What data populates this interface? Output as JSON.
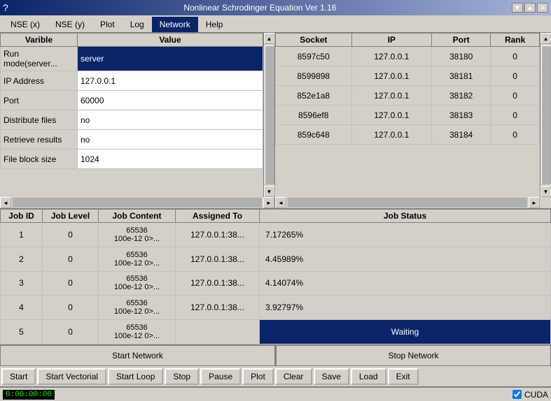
{
  "window": {
    "title": "Nonlinear Schrodinger Equation Ver 1.16",
    "icon": "app-icon"
  },
  "titlebar": {
    "minimize": "▼",
    "maximize": "▲",
    "close": "✕"
  },
  "menu": {
    "items": [
      {
        "label": "NSE (x)",
        "active": false
      },
      {
        "label": "NSE (y)",
        "active": false
      },
      {
        "label": "Plot",
        "active": false
      },
      {
        "label": "Log",
        "active": false
      },
      {
        "label": "Network",
        "active": true
      },
      {
        "label": "Help",
        "active": false
      }
    ]
  },
  "variables": {
    "header_varible": "Varible",
    "header_value": "Value",
    "rows": [
      {
        "label": "Run mode(server...",
        "value": "server",
        "highlight": true
      },
      {
        "label": "IP Address",
        "value": "127.0.0.1",
        "highlight": false
      },
      {
        "label": "Port",
        "value": "60000",
        "highlight": false
      },
      {
        "label": "Distribute files",
        "value": "no",
        "highlight": false
      },
      {
        "label": "Retrieve results",
        "value": "no",
        "highlight": false
      },
      {
        "label": "File block size",
        "value": "1024",
        "highlight": false
      }
    ]
  },
  "sockets": {
    "headers": [
      "Socket",
      "IP",
      "Port",
      "Rank"
    ],
    "rows": [
      {
        "socket": "8597c50",
        "ip": "127.0.0.1",
        "port": "38180",
        "rank": "0"
      },
      {
        "socket": "8599898",
        "ip": "127.0.0.1",
        "port": "38181",
        "rank": "0"
      },
      {
        "socket": "852e1a8",
        "ip": "127.0.0.1",
        "port": "38182",
        "rank": "0"
      },
      {
        "socket": "8596ef8",
        "ip": "127.0.0.1",
        "port": "38183",
        "rank": "0"
      },
      {
        "socket": "859c648",
        "ip": "127.0.0.1",
        "port": "38184",
        "rank": "0"
      }
    ]
  },
  "jobs": {
    "headers": [
      "Job ID",
      "Job Level",
      "Job Content",
      "Assigned To",
      "Job Status"
    ],
    "rows": [
      {
        "id": "1",
        "level": "0",
        "content": "65536\n100e-12 0>...",
        "assigned": "127.0.0.1:38...",
        "status": "7.17265%",
        "waiting": false
      },
      {
        "id": "2",
        "level": "0",
        "content": "65536\n100e-12 0>...",
        "assigned": "127.0.0.1:38...",
        "status": "4.45989%",
        "waiting": false
      },
      {
        "id": "3",
        "level": "0",
        "content": "65536\n100e-12 0>...",
        "assigned": "127.0.0.1:38...",
        "status": "4.14074%",
        "waiting": false
      },
      {
        "id": "4",
        "level": "0",
        "content": "65536\n100e-12 0>...",
        "assigned": "127.0.0.1:38...",
        "status": "3.92797%",
        "waiting": false
      },
      {
        "id": "5",
        "level": "0",
        "content": "65536\n100e-12 0>...",
        "assigned": "",
        "status": "Waiting",
        "waiting": true
      }
    ]
  },
  "network_buttons": {
    "start": "Start Network",
    "stop": "Stop Network"
  },
  "action_buttons": {
    "start": "Start",
    "start_vectorial": "Start Vectorial",
    "start_loop": "Start Loop",
    "stop": "Stop",
    "pause": "Pause",
    "plot": "Plot",
    "clear": "Clear",
    "save": "Save",
    "load": "Load",
    "exit": "Exit"
  },
  "status_bar": {
    "time": "0:00:00:00",
    "cuda_label": "CUDA",
    "cuda_checked": true
  }
}
